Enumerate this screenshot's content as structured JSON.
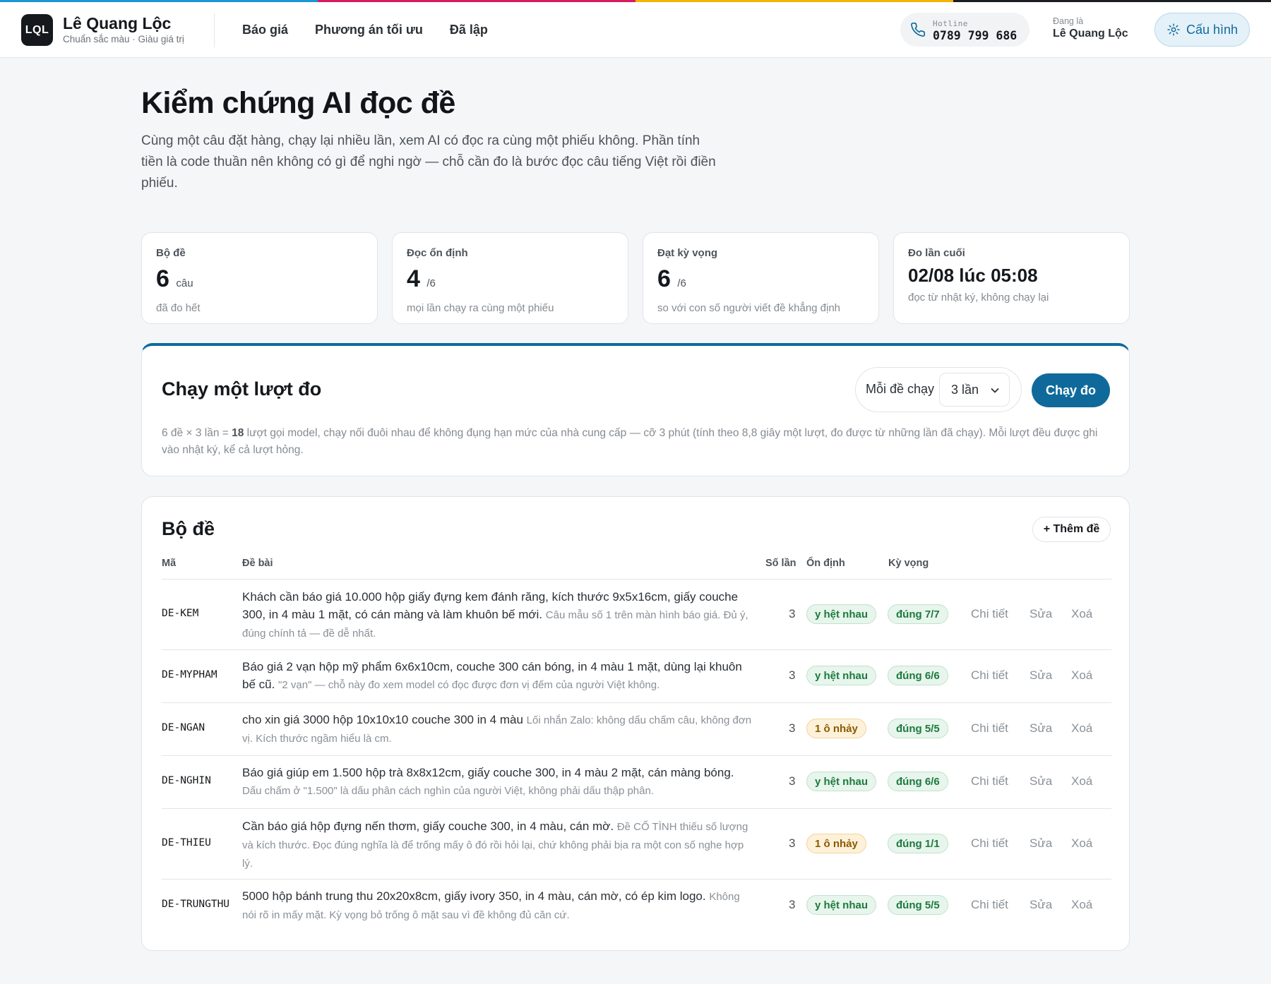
{
  "colors": {
    "stripe": [
      "#1a96d3",
      "#d81b60",
      "#f4b400",
      "#1a1d21"
    ],
    "accent": "#0f6a9b",
    "ok_pill": "#e7f5ec",
    "warn_pill": "#fdf1d9"
  },
  "header": {
    "logo": "LQL",
    "brand_name": "Lê Quang Lộc",
    "brand_tagline": "Chuẩn sắc màu · Giàu giá trị",
    "nav": [
      "Báo giá",
      "Phương án tối ưu",
      "Đã lập"
    ],
    "hotline_label": "Hotline",
    "hotline_number": "0789 799 686",
    "user_label": "Đang là",
    "user_name": "Lê Quang Lộc",
    "config_label": "Cấu hình"
  },
  "hero": {
    "title": "Kiểm chứng AI đọc đề",
    "description": "Cùng một câu đặt hàng, chạy lại nhiều lần, xem AI có đọc ra cùng một phiếu không. Phần tính tiền là code thuần nên không có gì để nghi ngờ — chỗ cần đo là bước đọc câu tiếng Việt rồi điền phiếu."
  },
  "stats": [
    {
      "label": "Bộ đề",
      "value": "6",
      "unit": "câu",
      "note": "đã đo hết"
    },
    {
      "label": "Đọc ổn định",
      "value": "4",
      "unit": "/6",
      "note": "mọi lần chạy ra cùng một phiếu"
    },
    {
      "label": "Đạt kỳ vọng",
      "value": "6",
      "unit": "/6",
      "note": "so với con số người viết đề khẳng định"
    },
    {
      "label": "Đo lần cuối",
      "value": "02/08 lúc 05:08",
      "unit": "",
      "note": "đọc từ nhật ký, không chạy lại"
    }
  ],
  "run": {
    "title": "Chạy một lượt đo",
    "per_question_label": "Mỗi đề chạy",
    "selected_runs": "3 lần",
    "run_button": "Chạy đo",
    "desc_before": "6 đề × 3 lần = ",
    "desc_bold": "18",
    "desc_after": " lượt gọi model, chạy nối đuôi nhau để không đụng hạn mức của nhà cung cấp — cỡ 3 phút (tính theo 8,8 giây một lượt, đo được từ những lần đã chạy). Mỗi lượt đều được ghi vào nhật ký, kể cả lượt hỏng."
  },
  "question_set": {
    "title": "Bộ đề",
    "add_button": "+ Thêm đề",
    "headers": {
      "code": "Mã",
      "prompt": "Đề bài",
      "runs": "Số lần",
      "stability": "Ổn định",
      "expectation": "Kỳ vọng"
    },
    "actions": {
      "detail": "Chi tiết",
      "edit": "Sửa",
      "delete": "Xoá"
    },
    "rows": [
      {
        "code": "DE-KEM",
        "text": "Khách cần báo giá 10.000 hộp giấy đựng kem đánh răng, kích thước 9x5x16cm, giấy couche 300, in 4 màu 1 mặt, có cán màng và làm khuôn bế mới.",
        "note": "Câu mẫu số 1 trên màn hình báo giá. Đủ ý, đúng chính tả — đề dễ nhất.",
        "runs": "3",
        "stability": "y hệt nhau",
        "stability_ok": true,
        "expectation": "đúng 7/7"
      },
      {
        "code": "DE-MYPHAM",
        "text": "Báo giá 2 vạn hộp mỹ phẩm 6x6x10cm, couche 300 cán bóng, in 4 màu 1 mặt, dùng lại khuôn bế cũ.",
        "note": "\"2 vạn\" — chỗ này đo xem model có đọc được đơn vị đếm của người Việt không.",
        "runs": "3",
        "stability": "y hệt nhau",
        "stability_ok": true,
        "expectation": "đúng 6/6"
      },
      {
        "code": "DE-NGAN",
        "text": "cho xin giá 3000 hộp 10x10x10 couche 300 in 4 màu",
        "note": "Lối nhắn Zalo: không dấu chấm câu, không đơn vị. Kích thước ngầm hiểu là cm.",
        "runs": "3",
        "stability": "1 ô nhảy",
        "stability_ok": false,
        "expectation": "đúng 5/5"
      },
      {
        "code": "DE-NGHIN",
        "text": "Báo giá giúp em 1.500 hộp trà 8x8x12cm, giấy couche 300, in 4 màu 2 mặt, cán màng bóng.",
        "note": "Dấu chấm ở \"1.500\" là dấu phân cách nghìn của người Việt, không phải dấu thập phân.",
        "runs": "3",
        "stability": "y hệt nhau",
        "stability_ok": true,
        "expectation": "đúng 6/6"
      },
      {
        "code": "DE-THIEU",
        "text": "Cần báo giá hộp đựng nến thơm, giấy couche 300, in 4 màu, cán mờ.",
        "note": "Đề CỐ TÌNH thiếu số lượng và kích thước. Đọc đúng nghĩa là để trống mấy ô đó rồi hỏi lại, chứ không phải bịa ra một con số nghe hợp lý.",
        "runs": "3",
        "stability": "1 ô nhảy",
        "stability_ok": false,
        "expectation": "đúng 1/1"
      },
      {
        "code": "DE-TRUNGTHU",
        "text": "5000 hộp bánh trung thu 20x20x8cm, giấy ivory 350, in 4 màu, cán mờ, có ép kim logo.",
        "note": "Không nói rõ in mấy mặt. Kỳ vọng bỏ trống ô mặt sau vì đề không đủ căn cứ.",
        "runs": "3",
        "stability": "y hệt nhau",
        "stability_ok": true,
        "expectation": "đúng 5/5"
      }
    ]
  }
}
